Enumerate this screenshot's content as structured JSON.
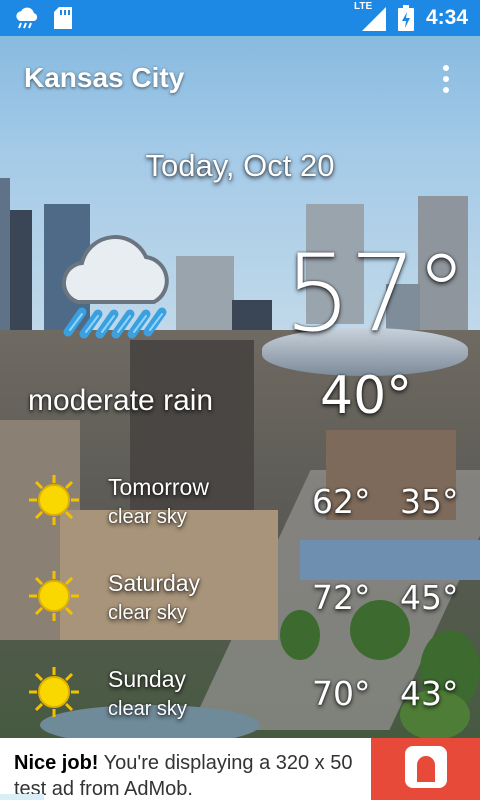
{
  "status_bar": {
    "time": "4:34",
    "network": "LTE",
    "icons": [
      "weather-rain-notification-icon",
      "sd-card-icon",
      "signal-icon",
      "battery-icon"
    ]
  },
  "app_bar": {
    "title": "Kansas City",
    "menu_icon": "overflow-menu-icon"
  },
  "today": {
    "date": "Today, Oct 20",
    "temp_high": "57°",
    "temp_low": "40°",
    "condition": "moderate rain",
    "icon": "rain-cloud-icon"
  },
  "forecast": [
    {
      "day": "Tomorrow",
      "condition": "clear sky",
      "high": "62°",
      "low": "35°",
      "icon": "sun-icon"
    },
    {
      "day": "Saturday",
      "condition": "clear sky",
      "high": "72°",
      "low": "45°",
      "icon": "sun-icon"
    },
    {
      "day": "Sunday",
      "condition": "clear sky",
      "high": "70°",
      "low": "43°",
      "icon": "sun-icon"
    }
  ],
  "ad": {
    "headline": "Nice job!",
    "body": "You're displaying a 320 x 50 test ad from AdMob."
  },
  "colors": {
    "status_bar": "#1e88e5",
    "ad_accent": "#e84a3a",
    "sun": "#f5d000"
  }
}
